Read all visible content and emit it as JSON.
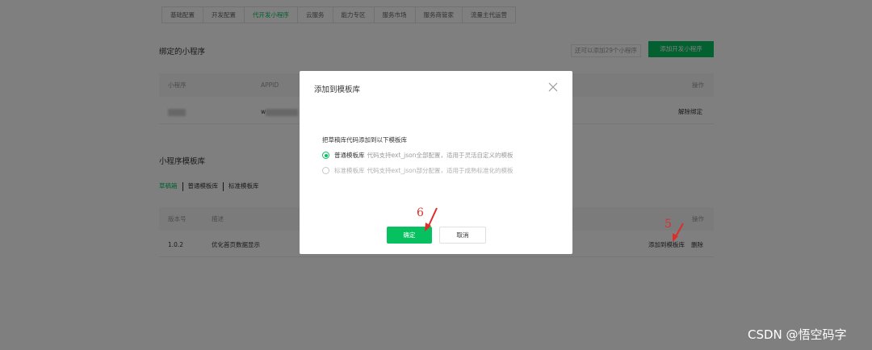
{
  "tabs": [
    {
      "label": "基础配置"
    },
    {
      "label": "开发配置"
    },
    {
      "label": "代开发小程序"
    },
    {
      "label": "云服务"
    },
    {
      "label": "能力专区"
    },
    {
      "label": "服务市场"
    },
    {
      "label": "服务商管家"
    },
    {
      "label": "流量主代运营"
    }
  ],
  "bound": {
    "title": "绑定的小程序",
    "hint": "还可以添加29个小程序",
    "add_button": "添加开发小程序",
    "columns": {
      "miniprogram": "小程序",
      "appid": "APPID",
      "action": "操作"
    },
    "row": {
      "appid_prefix": "w",
      "action": "解除绑定"
    }
  },
  "templates": {
    "title": "小程序模板库",
    "subtabs": [
      "草稿箱",
      "普通模板库",
      "标准模板库"
    ],
    "columns": {
      "version": "版本号",
      "desc": "描述",
      "action": "操作"
    },
    "row": {
      "version": "1.0.2",
      "desc": "优化首页数据显示",
      "add_action": "添加到模板库",
      "delete_action": "删除"
    }
  },
  "dialog": {
    "title": "添加到模板库",
    "description": "把草稿库代码添加到以下模板库",
    "options": [
      {
        "name": "普通模板库",
        "desc": "代码支持ext_json全部配置，适用于灵活自定义的模板",
        "checked": true
      },
      {
        "name": "标准模板库",
        "desc": "代码支持ext_json部分配置，适用于成熟标准化的模板",
        "checked": false
      }
    ],
    "ok_label": "确定",
    "cancel_label": "取消"
  },
  "annotations": {
    "step_ok": "6",
    "step_add": "5",
    "color": "#e02b2b"
  },
  "watermark": "CSDN @悟空码字",
  "colors": {
    "accent": "#07c160"
  }
}
